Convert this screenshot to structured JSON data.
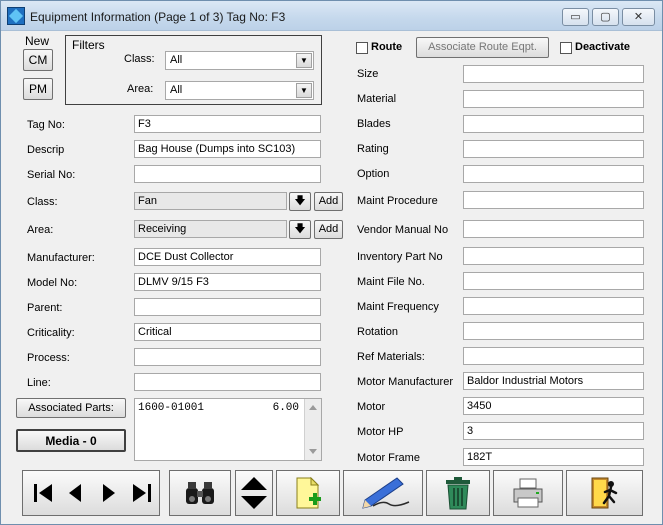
{
  "window": {
    "title": "Equipment Information (Page 1 of 3) Tag No: F3",
    "controls": {
      "minimize": "▭",
      "maximize": "▢",
      "close": "✕"
    }
  },
  "new_group": {
    "label": "New",
    "cm": "CM",
    "pm": "PM"
  },
  "filters": {
    "title": "Filters",
    "class_label": "Class:",
    "class_value": "All",
    "area_label": "Area:",
    "area_value": "All"
  },
  "left_fields": {
    "tag_no": {
      "label": "Tag No:",
      "value": "F3"
    },
    "descrip": {
      "label": "Descrip",
      "value": "Bag House (Dumps into SC103)"
    },
    "serial_no": {
      "label": "Serial No:",
      "value": ""
    },
    "class": {
      "label": "Class:",
      "value": "Fan",
      "add": "Add"
    },
    "area": {
      "label": "Area:",
      "value": "Receiving",
      "add": "Add"
    },
    "manufacturer": {
      "label": "Manufacturer:",
      "value": "DCE Dust Collector"
    },
    "model_no": {
      "label": "Model No:",
      "value": "DLMV 9/15 F3"
    },
    "parent": {
      "label": "Parent:",
      "value": ""
    },
    "criticality": {
      "label": "Criticality:",
      "value": "Critical"
    },
    "process": {
      "label": "Process:",
      "value": ""
    },
    "line": {
      "label": "Line:",
      "value": ""
    }
  },
  "associated_parts": {
    "button": "Associated Parts:",
    "rows": [
      {
        "part": "1600-01001",
        "qty": "6.00"
      }
    ]
  },
  "media_button": "Media - 0",
  "top_right": {
    "route_label": "Route",
    "associate_route": "Associate Route Eqpt.",
    "deactivate_label": "Deactivate"
  },
  "right_fields": [
    {
      "label": "Size",
      "value": ""
    },
    {
      "label": "Material",
      "value": ""
    },
    {
      "label": "Blades",
      "value": ""
    },
    {
      "label": "Rating",
      "value": ""
    },
    {
      "label": "Option",
      "value": ""
    },
    {
      "label": "Maint Procedure",
      "value": ""
    },
    {
      "label": "Vendor Manual No",
      "value": ""
    },
    {
      "label": "Inventory Part No",
      "value": ""
    },
    {
      "label": "Maint File No.",
      "value": ""
    },
    {
      "label": "Maint Frequency",
      "value": ""
    },
    {
      "label": "Rotation",
      "value": ""
    },
    {
      "label": "Ref Materials:",
      "value": ""
    },
    {
      "label": "Motor Manufacturer",
      "value": "Baldor Industrial Motors"
    },
    {
      "label": "Motor",
      "value": "3450"
    },
    {
      "label": "Motor HP",
      "value": "3"
    },
    {
      "label": "Motor Frame",
      "value": "182T"
    }
  ],
  "toolbar": [
    {
      "name": "first-record",
      "icon": "first-icon"
    },
    {
      "name": "previous-record",
      "icon": "previous-icon"
    },
    {
      "name": "next-record",
      "icon": "next-icon"
    },
    {
      "name": "last-record",
      "icon": "last-icon"
    },
    {
      "name": "find",
      "icon": "binoculars-icon"
    },
    {
      "name": "sort-up-down",
      "icon": "up-down-icon"
    },
    {
      "name": "new-record",
      "icon": "new-document-icon"
    },
    {
      "name": "edit-record",
      "icon": "pen-icon"
    },
    {
      "name": "delete-record",
      "icon": "trash-icon"
    },
    {
      "name": "print",
      "icon": "printer-icon"
    },
    {
      "name": "exit",
      "icon": "exit-door-icon"
    }
  ]
}
